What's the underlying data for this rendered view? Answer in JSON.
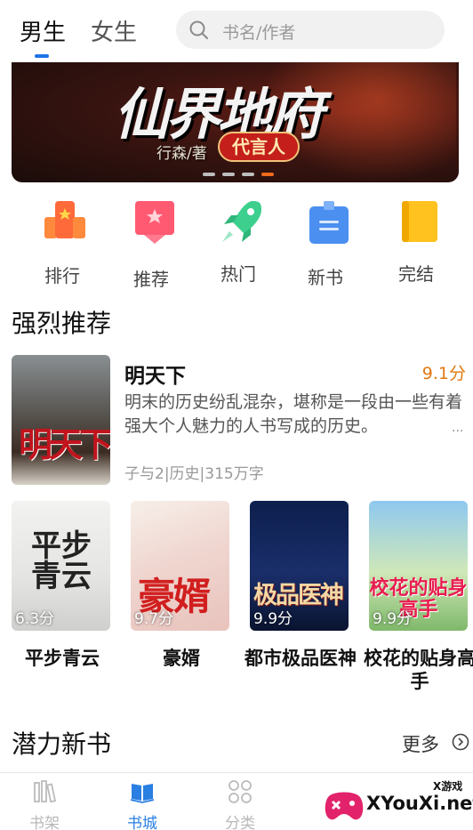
{
  "top": {
    "tabs": [
      {
        "label": "男生",
        "active": true
      },
      {
        "label": "女生",
        "active": false
      }
    ],
    "search": {
      "placeholder": "书名/作者",
      "icon": "search-icon"
    },
    "accent_color": "#1e73e8"
  },
  "banner": {
    "title": "仙界地府",
    "author_text": "行森/著",
    "badge": "代言人",
    "active_dot_color": "#f06a1c"
  },
  "categories": [
    {
      "label": "排行",
      "icon": "ranking-icon"
    },
    {
      "label": "推荐",
      "icon": "recommend-icon"
    },
    {
      "label": "热门",
      "icon": "rocket-icon"
    },
    {
      "label": "新书",
      "icon": "new-book-icon"
    },
    {
      "label": "完结",
      "icon": "finished-book-icon"
    }
  ],
  "recommended": {
    "title": "强烈推荐",
    "featured": {
      "cover_text": "明天下",
      "title": "明天下",
      "score": "9.1分",
      "description": "明末的历史纷乱混杂，堪称是一段由一些有着强大个人魅力的人书写成的历史。",
      "more": "...",
      "meta": "子与2|历史|315万字",
      "score_color": "#e07a12"
    },
    "books": [
      {
        "title": "平步青云",
        "score": "6.3分",
        "cover_text": "平步青云"
      },
      {
        "title": "豪婿",
        "score": "9.7分",
        "cover_text": "豪婿"
      },
      {
        "title": "都市极品医神",
        "score": "9.9分",
        "cover_text": "极品医神"
      },
      {
        "title": "校花的贴身高手",
        "score": "9.9分",
        "cover_text": "校花的贴身高手"
      }
    ]
  },
  "new_books": {
    "title": "潜力新书",
    "more": "更多"
  },
  "bottom_nav": [
    {
      "label": "书架",
      "icon": "bookshelf-icon",
      "active": false
    },
    {
      "label": "书城",
      "icon": "bookstore-icon",
      "active": true
    },
    {
      "label": "分类",
      "icon": "category-grid-icon",
      "active": false
    }
  ],
  "watermark": {
    "text": "XYouXi.net",
    "small": "X游戏"
  }
}
